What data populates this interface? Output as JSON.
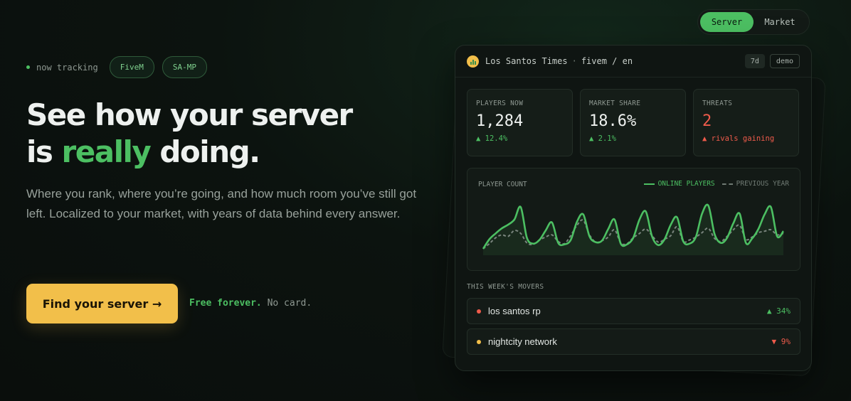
{
  "nav": {
    "toggle": [
      {
        "label": "Server",
        "active": true
      },
      {
        "label": "Market",
        "active": false
      }
    ]
  },
  "hero": {
    "tracking_label": "now tracking",
    "chips": [
      "FiveM",
      "SA-MP"
    ],
    "headline_line1": "See how your server",
    "headline_line2_prefix": "is ",
    "headline_accent": "really",
    "headline_line2_suffix": " doing.",
    "subtext": "Where you rank, where you’re going, and how much room you’ve still got left. Localized to your market, with years of data behind every answer.",
    "cta_label": "Find your server →",
    "free_strong": "Free forever.",
    "free_rest": "No card."
  },
  "card": {
    "title": "Los Santos Times",
    "separator": "·",
    "subtitle": "fivem / en",
    "badge_range": "7d",
    "badge_demo": "demo",
    "back_badge": "demo",
    "stats": [
      {
        "label": "PLAYERS NOW",
        "value": "1,284",
        "delta": "▲ 12.4%",
        "tone": "up"
      },
      {
        "label": "MARKET SHARE",
        "value": "18.6%",
        "delta": "▲ 2.1%",
        "tone": "up"
      },
      {
        "label": "THREATS",
        "value": "2",
        "delta": "▲ rivals gaining",
        "tone": "down"
      }
    ],
    "movers_label": "THIS WEEK'S MOVERS",
    "movers": [
      {
        "name": "los santos rp",
        "change": "▲ 34%",
        "dot_color": "#ef5b4b",
        "change_color": "#4cbf62"
      },
      {
        "name": "nightcity network",
        "change": "▼ 9%",
        "dot_color": "#f2bf4a",
        "change_color": "#ef5b4b"
      }
    ]
  },
  "colors": {
    "accent_green": "#4cbf62",
    "accent_yellow": "#f2bf4a",
    "danger_red": "#ef5b4b",
    "background": "#0c130f"
  },
  "chart_data": {
    "type": "line",
    "title": "PLAYER COUNT",
    "series": [
      {
        "name": "ONLINE PLAYERS",
        "style": "solid",
        "color": "#4cbf62",
        "values": [
          5,
          18,
          26,
          33,
          38,
          45,
          62,
          20,
          12,
          17,
          30,
          41,
          13,
          11,
          17,
          42,
          52,
          22,
          14,
          16,
          32,
          45,
          12,
          11,
          20,
          45,
          56,
          22,
          10,
          18,
          38,
          48,
          15,
          12,
          21,
          53,
          64,
          25,
          13,
          20,
          40,
          53,
          13,
          19,
          32,
          52,
          62,
          22,
          29
        ]
      },
      {
        "name": "PREVIOUS YEAR",
        "style": "dashed",
        "color": "#7a857e",
        "values": [
          5,
          12,
          20,
          24,
          22,
          30,
          26,
          13,
          11,
          17,
          21,
          24,
          15,
          12,
          23,
          37,
          44,
          24,
          14,
          16,
          21,
          31,
          13,
          12,
          20,
          26,
          32,
          23,
          14,
          18,
          23,
          35,
          15,
          17,
          21,
          27,
          33,
          19,
          15,
          22,
          31,
          37,
          18,
          21,
          27,
          29,
          31,
          24,
          26
        ]
      }
    ],
    "ylim": [
      0,
      70
    ],
    "grid": false,
    "legend": "top-right"
  }
}
